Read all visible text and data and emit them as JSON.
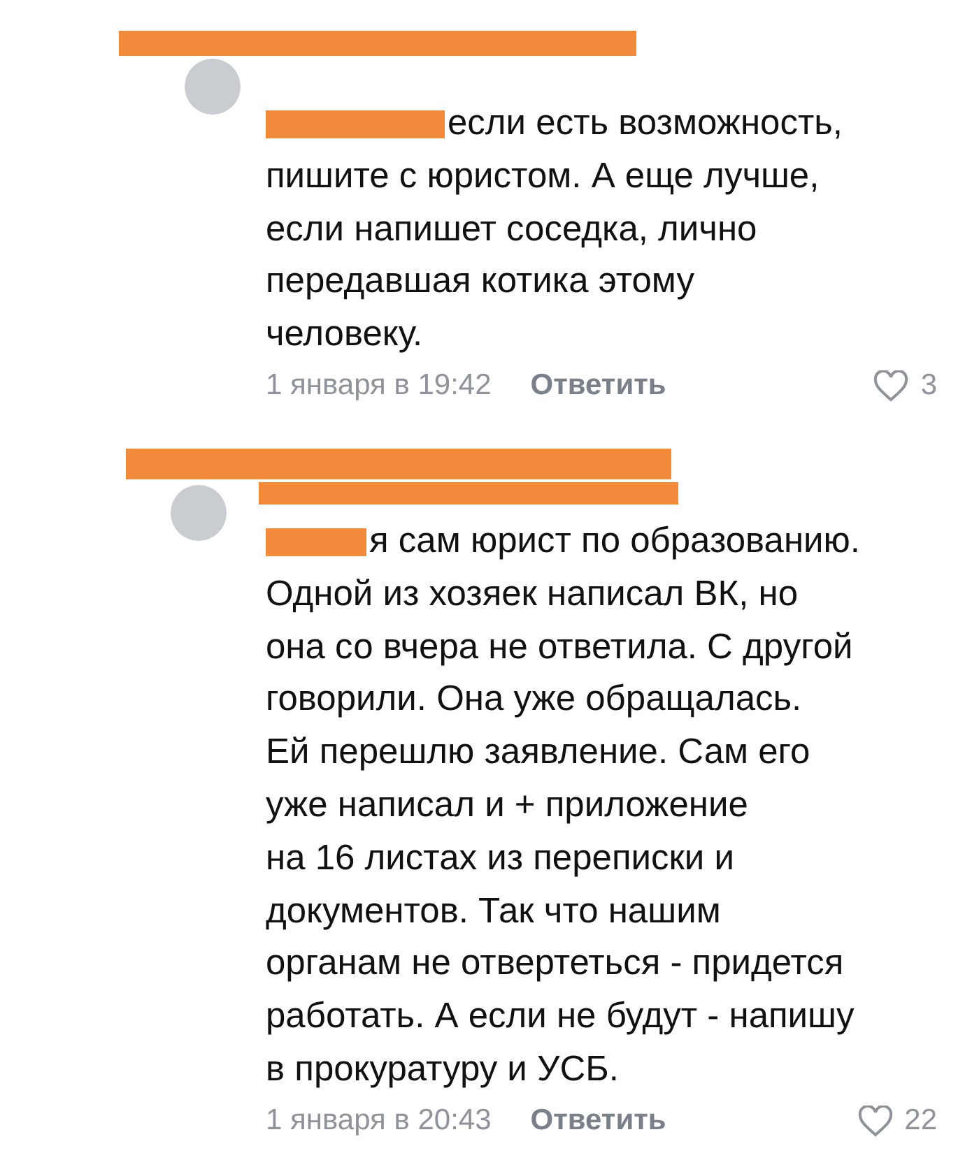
{
  "comments": [
    {
      "text": "если есть возможность,\nпишите с юристом. А еще лучше,\nесли напишет соседка, лично\nпередавшая котика этому\nчеловеку.",
      "date": "1 января в 19:42",
      "reply": "Ответить",
      "likes": "3"
    },
    {
      "text": "я сам юрист по образованию.\nОдной из хозяек написал ВК, но\nона со вчера не ответила. С другой\nговорили. Она уже обращалась.\nЕй перешлю заявление. Сам его\nуже написал и + приложение\nна 16 листах из переписки и\nдокументов. Так что нашим\nорганам не отвертеться - придется\nработать. А если не будут - напишу\nв прокуратуру и УСБ.",
      "date": "1 января в 20:43",
      "reply": "Ответить",
      "likes": "22"
    }
  ]
}
